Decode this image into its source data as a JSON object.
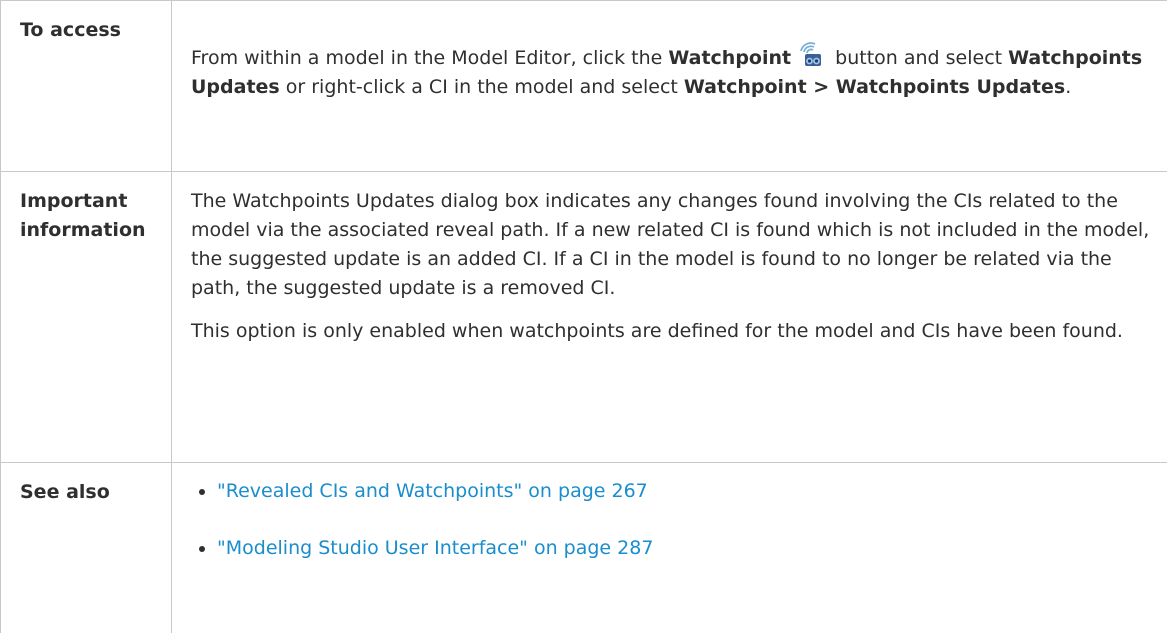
{
  "rows": {
    "access": {
      "label": "To access",
      "text_1": "From within a model in the Model Editor, click the ",
      "bold_1": "Watchpoint",
      "icon": "binoculars-radar-icon",
      "text_2": " button and select ",
      "bold_2": "Watchpoints Updates",
      "text_3": " or right-click a CI in the model and select ",
      "bold_3": "Watchpoint > Watchpoints Updates",
      "text_4": "."
    },
    "important": {
      "label": "Important information",
      "paragraph_1": "The Watchpoints Updates dialog box indicates any changes found involving the CIs related to the model via the associated reveal path. If a new related CI is found which is not included in the model, the suggested update is an added CI. If a CI in the model is found to no longer be related via the path, the suggested update is a removed CI.",
      "paragraph_2": "This option is only enabled when watchpoints are defined for the model and CIs have been found."
    },
    "see_also": {
      "label": "See also",
      "links": [
        {
          "text": "\"Revealed CIs and Watchpoints\" on page 267"
        },
        {
          "text": "\"Modeling Studio User Interface\" on page 287"
        }
      ]
    }
  },
  "colors": {
    "link": "#1a8dcc",
    "border": "#c8c8c8",
    "text": "#2f2f2f"
  }
}
